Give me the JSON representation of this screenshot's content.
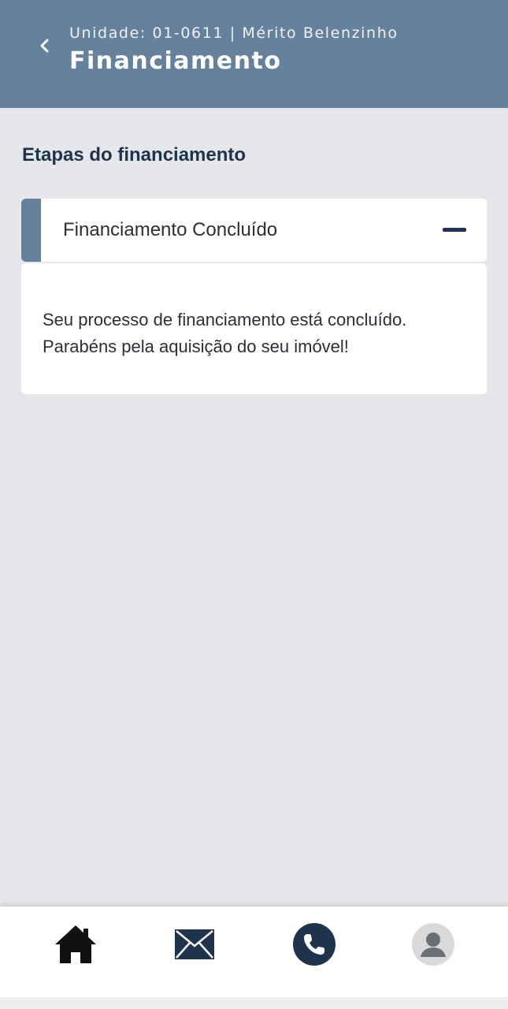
{
  "header": {
    "subtitle": "Unidade: 01-0611 | Mérito Belenzinho",
    "title": "Financiamento",
    "back_icon": "chevron-left-icon"
  },
  "section": {
    "title": "Etapas do financiamento"
  },
  "accordion": {
    "label": "Financiamento Concluído",
    "state_icon": "minus-icon",
    "body_line1": "Seu processo de financiamento está concluído.",
    "body_line2": "Parabéns pela aquisição do seu imóvel!"
  },
  "bottom_nav": {
    "items": [
      {
        "icon": "home-icon"
      },
      {
        "icon": "mail-icon"
      },
      {
        "icon": "phone-icon"
      },
      {
        "icon": "profile-icon"
      }
    ]
  },
  "colors": {
    "header_bg": "#65819b",
    "page_bg": "#e6e7ea",
    "accent": "#65819b",
    "dark_navy": "#1f344c"
  }
}
